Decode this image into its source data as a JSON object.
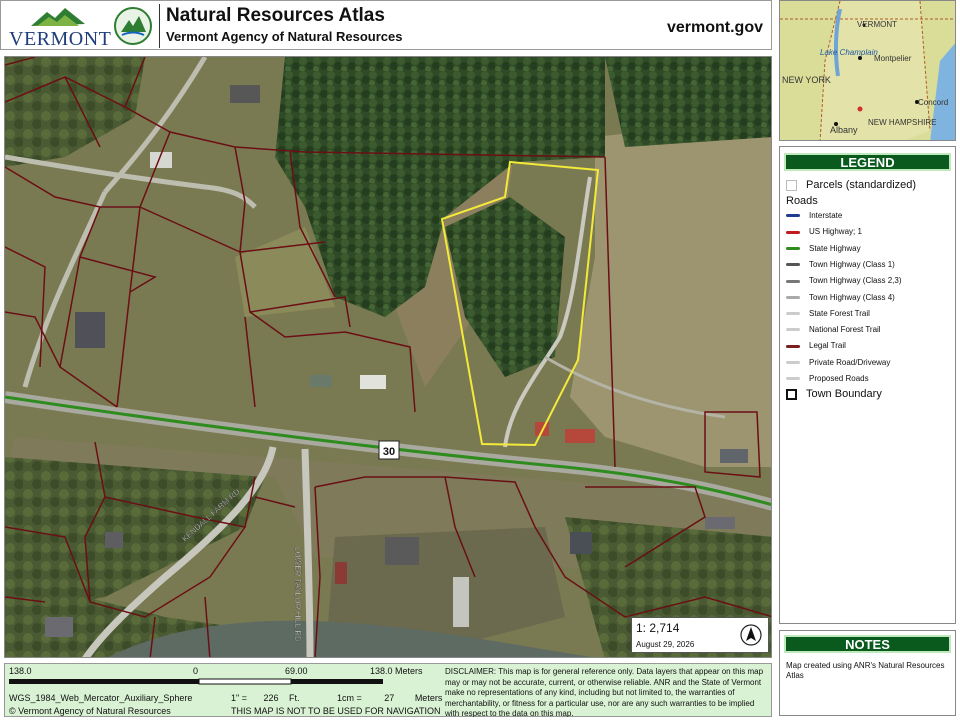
{
  "header": {
    "logo_text": "VERMONT",
    "title": "Natural Resources Atlas",
    "subtitle": "Vermont Agency of Natural Resources",
    "website": "vermont.gov"
  },
  "map": {
    "route_shield": "30",
    "road_labels": [
      "KENDALL FARM RD",
      "LOWER TAYLOR HILL RD"
    ],
    "scale": {
      "label": "1:",
      "value": "2,714"
    },
    "date": "August 29, 2026"
  },
  "inset": {
    "place_labels": [
      "VERMONT",
      "Lake Champlain",
      "Montpelier",
      "NEW YORK",
      "Concord",
      "NEW HAMPSHIRE",
      "Albany"
    ]
  },
  "legend": {
    "title": "LEGEND",
    "parcels_label": "Parcels (standardized)",
    "roads_heading": "Roads",
    "roads": [
      {
        "label": "Interstate",
        "color": "#1f3d8f"
      },
      {
        "label": "US Highway; 1",
        "color": "#c2191d"
      },
      {
        "label": "State Highway",
        "color": "#2e8b1d"
      },
      {
        "label": "Town Highway (Class 1)",
        "color": "#555555"
      },
      {
        "label": "Town Highway (Class 2,3)",
        "color": "#777777"
      },
      {
        "label": "Town Highway (Class 4)",
        "color": "#aaaaaa"
      },
      {
        "label": "State Forest Trail",
        "color": "#cccccc"
      },
      {
        "label": "National Forest Trail",
        "color": "#cccccc"
      },
      {
        "label": "Legal Trail",
        "color": "#7a1f1f"
      },
      {
        "label": "Private Road/Driveway",
        "color": "#cccccc"
      },
      {
        "label": "Proposed Roads",
        "color": "#cccccc"
      }
    ],
    "town_boundary_label": "Town Boundary"
  },
  "notes": {
    "title": "NOTES",
    "text": "Map created using ANR's Natural Resources Atlas"
  },
  "footer": {
    "scale_ticks": [
      "138.0",
      "0",
      "69.00",
      "138.0 Meters"
    ],
    "projection": "WGS_1984_Web_Mercator_Auxiliary_Sphere",
    "inch_label": "1\" =",
    "inch_value": "226",
    "inch_unit": "Ft.",
    "cm_label": "1cm =",
    "cm_value": "27",
    "cm_unit": "Meters",
    "copyright": "© Vermont Agency of Natural Resources",
    "navigation": "THIS MAP IS NOT TO BE USED FOR NAVIGATION",
    "disclaimer": "DISCLAIMER: This map is for general reference only. Data layers that appear on this map may or may not be accurate, current, or otherwise reliable. ANR and the State of Vermont make no representations of any kind, including but not limited to, the warranties of merchantability, or fitness for a particular use, nor are any such warranties to be implied with respect to the data on this map."
  }
}
